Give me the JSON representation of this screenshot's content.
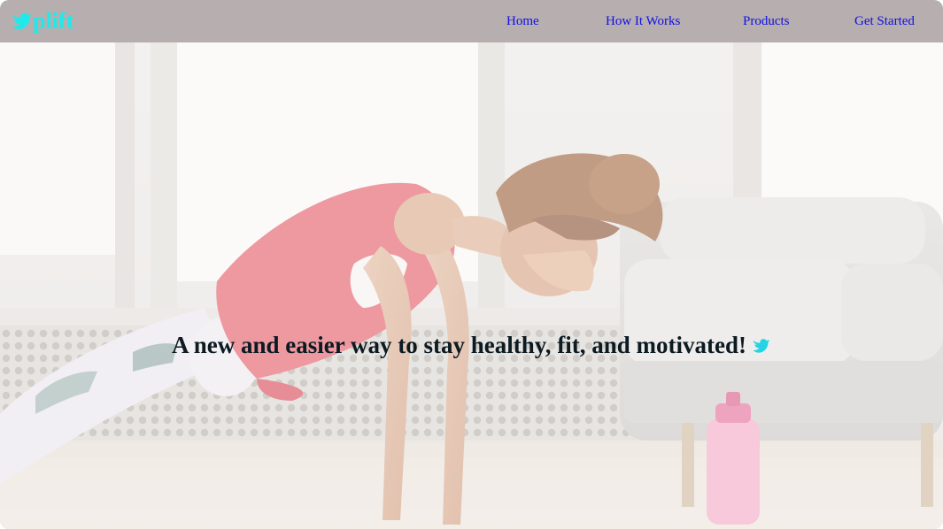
{
  "brand": {
    "text": "plift",
    "icon": "bird-icon",
    "color": "#22e9e9"
  },
  "nav": {
    "items": [
      {
        "label": "Home"
      },
      {
        "label": "How It Works"
      },
      {
        "label": "Products"
      },
      {
        "label": "Get Started"
      }
    ],
    "link_color": "#1010e0",
    "background": "#b7aeaf"
  },
  "hero": {
    "headline": "A new and easier way to stay healthy, fit, and motivated!",
    "headline_icon": "bird-icon",
    "image": "woman-doing-push-up-in-living-room"
  }
}
